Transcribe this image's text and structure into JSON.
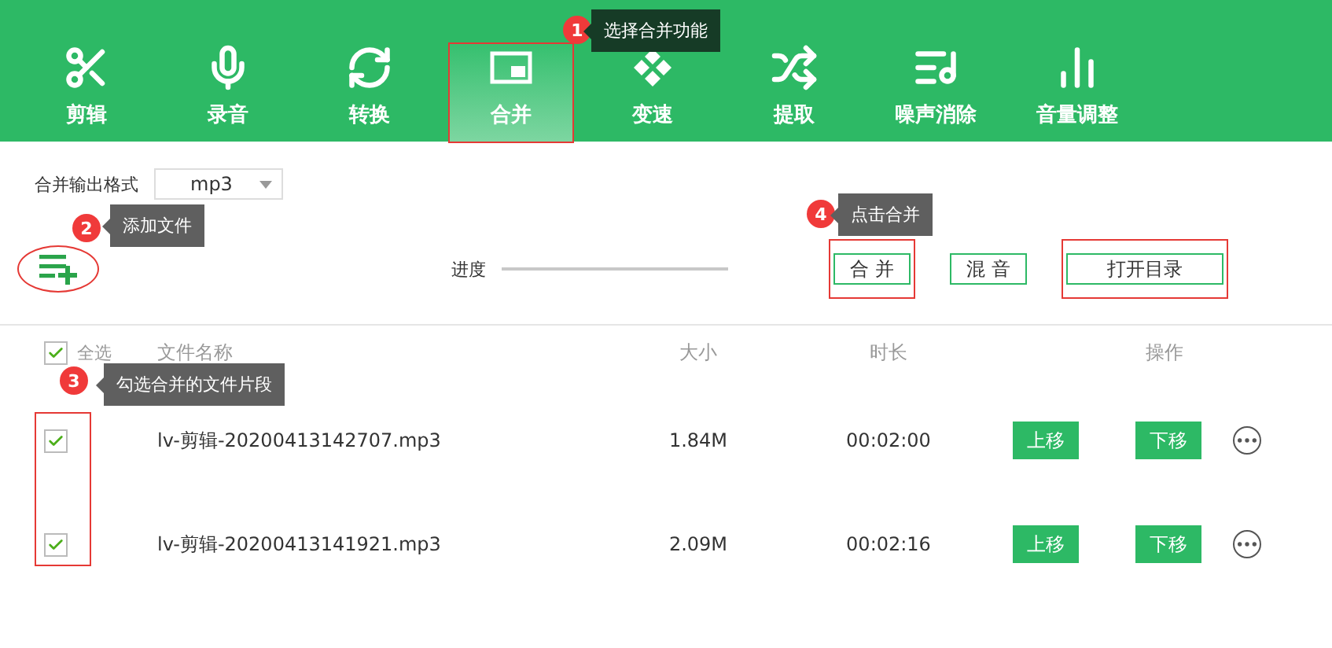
{
  "toolbar": {
    "tabs": [
      {
        "label": "剪辑",
        "selected": false,
        "marked": false
      },
      {
        "label": "录音",
        "selected": false,
        "marked": false
      },
      {
        "label": "转换",
        "selected": false,
        "marked": false
      },
      {
        "label": "合并",
        "selected": true,
        "marked": true
      },
      {
        "label": "变速",
        "selected": false,
        "marked": false
      },
      {
        "label": "提取",
        "selected": false,
        "marked": false
      },
      {
        "label": "噪声消除",
        "selected": false,
        "marked": false
      },
      {
        "label": "音量调整",
        "selected": false,
        "marked": false
      }
    ]
  },
  "settings": {
    "format_label": "合并输出格式",
    "format_value": "mp3",
    "add_marked": true,
    "progress_label": "进度",
    "buttons": [
      {
        "label": "合 并",
        "marked": true
      },
      {
        "label": "混 音",
        "marked": false
      },
      {
        "label": "打开目录",
        "marked": true
      }
    ]
  },
  "table": {
    "select_all": {
      "label": "全选",
      "checked": true
    },
    "columns": [
      "文件名称",
      "大小",
      "时长",
      "操作"
    ],
    "checkboxes_marked": true,
    "rows": [
      {
        "checked": true,
        "name": "lv-剪辑-20200413142707.mp3",
        "size": "1.84M",
        "duration": "00:02:00",
        "actions": [
          "上移",
          "下移"
        ]
      },
      {
        "checked": true,
        "name": "lv-剪辑-20200413141921.mp3",
        "size": "2.09M",
        "duration": "00:02:16",
        "actions": [
          "上移",
          "下移"
        ]
      }
    ]
  },
  "annotations": [
    {
      "number": "1",
      "text": "选择合并功能"
    },
    {
      "number": "2",
      "text": "添加文件"
    },
    {
      "number": "3",
      "text": "勾选合并的文件片段"
    },
    {
      "number": "4",
      "text": "点击合并"
    }
  ]
}
